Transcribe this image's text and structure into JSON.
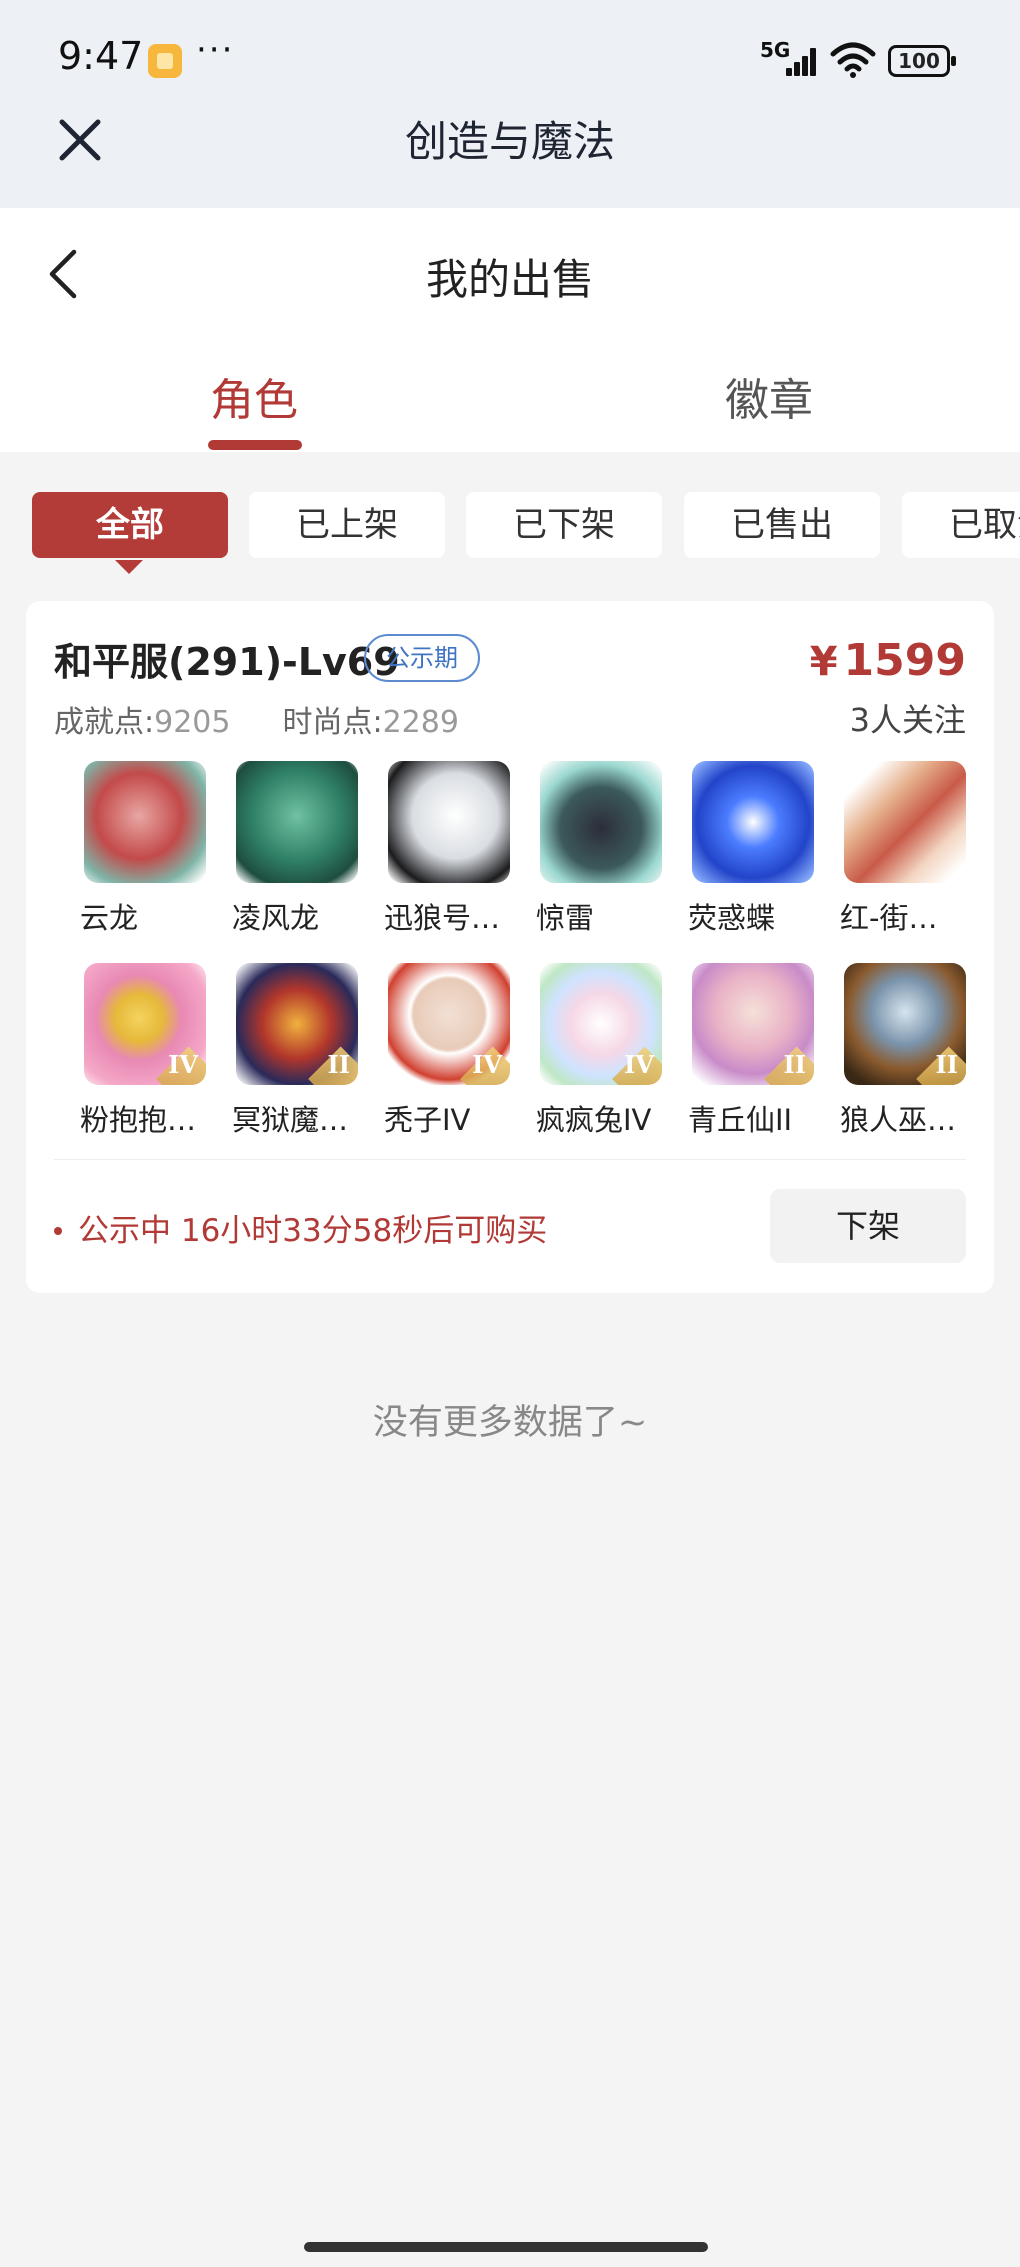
{
  "status_bar": {
    "time": "9:47",
    "dots": "···",
    "network": "5G",
    "battery": "100"
  },
  "app_bar": {
    "title": "创造与魔法"
  },
  "header": {
    "title": "我的出售",
    "tabs": [
      {
        "label": "角色",
        "active": true
      },
      {
        "label": "徽章",
        "active": false
      }
    ]
  },
  "filters": [
    {
      "label": "全部",
      "active": true
    },
    {
      "label": "已上架"
    },
    {
      "label": "已下架"
    },
    {
      "label": "已售出"
    },
    {
      "label": "已取消"
    }
  ],
  "listing": {
    "server": "和平服(291)-Lv69",
    "badge": "公示期",
    "price_symbol": "¥",
    "price": "1599",
    "achievement_label": "成就点:",
    "achievement_value": "9205",
    "fashion_label": "时尚点:",
    "fashion_value": "2289",
    "followers": "3人关注",
    "items": [
      {
        "name": "云龙",
        "icon": "yunlong-dragon-icon",
        "rank": ""
      },
      {
        "name": "凌风龙",
        "icon": "lingfeng-dragon-icon",
        "rank": ""
      },
      {
        "name": "迅狼号…",
        "icon": "mecha-wolf-icon",
        "rank": ""
      },
      {
        "name": "惊雷",
        "icon": "jinglei-beast-icon",
        "rank": ""
      },
      {
        "name": "荧惑蝶",
        "icon": "butterfly-icon",
        "rank": ""
      },
      {
        "name": "红-街…",
        "icon": "skateboard-icon",
        "rank": ""
      },
      {
        "name": "粉抱抱…",
        "icon": "pink-bear-icon",
        "rank": "IV"
      },
      {
        "name": "冥狱魔…",
        "icon": "demon-dragon-icon",
        "rank": "II"
      },
      {
        "name": "秃子IV",
        "icon": "bald-head-icon",
        "rank": "IV"
      },
      {
        "name": "疯疯兔IV",
        "icon": "crazy-rabbit-icon",
        "rank": "IV"
      },
      {
        "name": "青丘仙II",
        "icon": "fox-fairy-icon",
        "rank": "II"
      },
      {
        "name": "狼人巫…",
        "icon": "werewolf-icon",
        "rank": "II"
      }
    ],
    "countdown": "公示中 16小时33分58秒后可购买",
    "delist_label": "下架"
  },
  "footer": {
    "no_more": "没有更多数据了~"
  }
}
